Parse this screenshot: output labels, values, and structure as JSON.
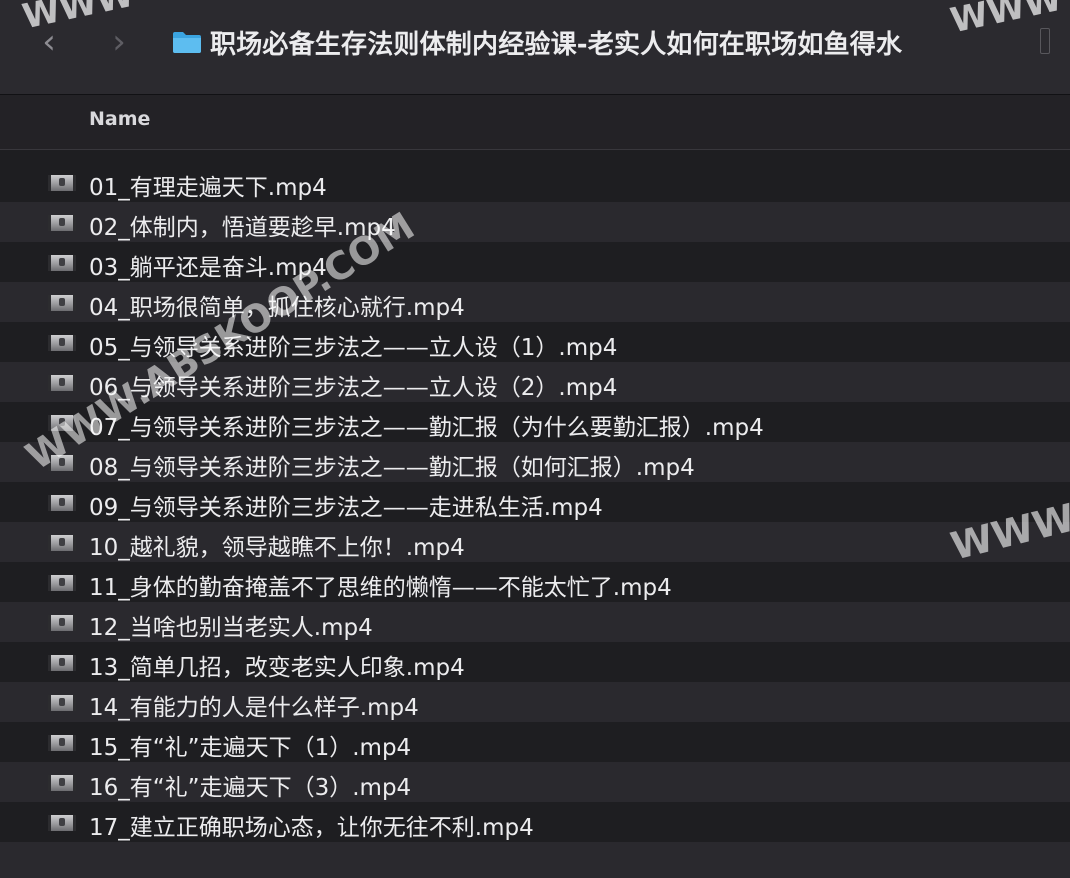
{
  "window": {
    "title": "职场必备生存法则体制内经验课-老实人如何在职场如鱼得水",
    "back_glyph": "‹",
    "forward_glyph": "›"
  },
  "icons": {
    "back": "chevron-left-icon",
    "forward": "chevron-right-icon",
    "folder": "folder-icon",
    "file": "video-thumbnail-icon"
  },
  "colors": {
    "background": "#1e1e21",
    "titlebar": "#2b2a2f",
    "folder": "#4fb3ea",
    "row_alt": "#2a292e"
  },
  "list": {
    "column_header": "Name",
    "files": [
      "01_有理走遍天下.mp4",
      "02_体制内，悟道要趁早.mp4",
      "03_躺平还是奋斗.mp4",
      "04_职场很简单，抓住核心就行.mp4",
      "05_与领导关系进阶三步法之——立人设（1）.mp4",
      "06_与领导关系进阶三步法之——立人设（2）.mp4",
      "07_与领导关系进阶三步法之——勤汇报（为什么要勤汇报）.mp4",
      "08_与领导关系进阶三步法之——勤汇报（如何汇报）.mp4",
      "09_与领导关系进阶三步法之——走进私生活.mp4",
      "10_越礼貌，领导越瞧不上你！.mp4",
      "11_身体的勤奋掩盖不了思维的懒惰——不能太忙了.mp4",
      "12_当啥也别当老实人.mp4",
      "13_简单几招，改变老实人印象.mp4",
      "14_有能力的人是什么样子.mp4",
      "15_有“礼”走遍天下（1）.mp4",
      "16_有“礼”走遍天下（3）.mp4",
      "17_建立正确职场心态，让你无往不利.mp4"
    ]
  },
  "watermarks": {
    "top_left": "WWW",
    "top_right": "WWW",
    "center": "WWW.ABSKOOP.COM",
    "right": "WWW"
  }
}
